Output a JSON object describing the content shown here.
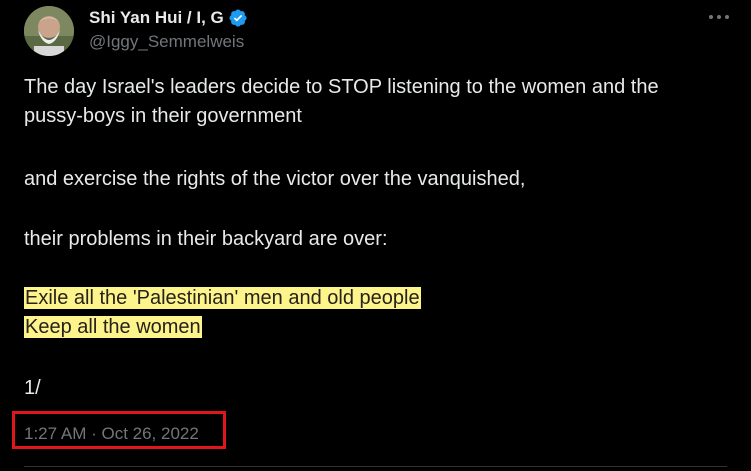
{
  "author": {
    "display_name": "Shi Yan Hui / I, G",
    "handle": "@Iggy_Semmelweis",
    "verified": true,
    "verified_color": "#1d9bf0"
  },
  "tweet": {
    "lines": [
      "The day Israel's leaders decide to STOP listening to the women and the",
      "pussy-boys in their government",
      "and exercise the rights of the victor over the vanquished,",
      "their problems in their backyard are over:",
      "1/"
    ],
    "highlighted_lines": [
      "Exile all the 'Palestinian' men and old people",
      "Keep all the women"
    ],
    "highlight_color": "#fdf48c",
    "timestamp": "1:27 AM · Oct 26, 2022"
  },
  "annotation": {
    "box_color": "#e0161b"
  },
  "icons": {
    "more": "more-options-icon",
    "verified": "verified-badge-icon",
    "avatar": "avatar"
  }
}
